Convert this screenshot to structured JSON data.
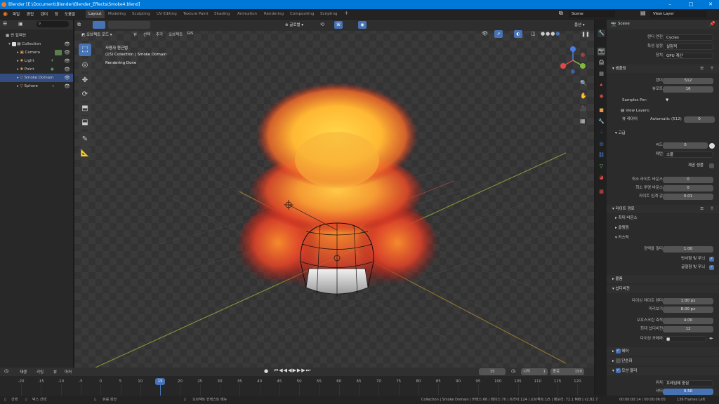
{
  "titlebar": {
    "title": "Blender [E:\\Document\\Blender\\Blender_Effects\\Smoke4.blend]"
  },
  "menu": {
    "items": [
      "파일",
      "편집",
      "렌더",
      "창",
      "도움말"
    ]
  },
  "workspaces": [
    "Layout",
    "Modeling",
    "Sculpting",
    "UV Editing",
    "Texture Paint",
    "Shading",
    "Animation",
    "Rendering",
    "Compositing",
    "Scripting"
  ],
  "scene": {
    "label": "Scene",
    "view_layer": "View Layer"
  },
  "outliner": {
    "root": "씬 컬렉션",
    "collection": "Collection",
    "items": [
      "Camera",
      "Light",
      "Point",
      "Smoke Domain",
      "Sphere"
    ]
  },
  "viewport": {
    "mode": "오브젝트 모드",
    "menus": [
      "뷰",
      "선택",
      "추가",
      "오브젝트",
      "GIS"
    ],
    "orientation": "글로벌",
    "options": "옵션",
    "info_line1": "사용자 원근법",
    "info_line2": "(15) Collection | Smoke Domain",
    "info_line3": "Rendering Done"
  },
  "properties": {
    "header": "Scene",
    "render_engine_label": "렌더 엔진",
    "render_engine": "Cycles",
    "feature_label": "특성 설정",
    "feature": "실험적",
    "device_label": "장치",
    "device": "GPU 계산",
    "sampling": "샘플링",
    "render_label": "렌더",
    "render_val": "512",
    "viewport_label": "뷰포트",
    "viewport_val": "16",
    "samples_per": "Samples Per:",
    "view_layers": "View Layers:",
    "view_layer_label": "뷰 레이어",
    "view_layer_auto": "Automatic (512)",
    "view_layer_val": "0",
    "advanced": "고급",
    "seed_label": "씨드",
    "seed_val": "0",
    "pattern_label": "패턴",
    "pattern": "소볼",
    "square_samples": "제곱 샘플",
    "min_light_bounce_label": "최소 라이트 바운스",
    "min_light_bounce": "0",
    "min_transp_bounce_label": "최소 투명 바운스",
    "min_transp_bounce": "0",
    "light_threshold_label": "라이트 임계 값",
    "light_threshold": "0.01",
    "light_paths": "라이트 경로",
    "max_bounces": "최대 바운스",
    "clamping": "클램핑",
    "caustics": "커스틱",
    "filter_glossy_label": "광택을 필터",
    "filter_glossy": "1.00",
    "reflective_caustics": "반사형 빛 무늬",
    "refractive_caustics": "굴절형 빛 무늬",
    "volumes": "볼륨",
    "subdivision": "섭디비전",
    "dicing_rate_render_label": "다이싱 레이트 렌더",
    "dicing_rate_render": "1.00 px",
    "preview_label": "미리보기",
    "preview": "8.00 px",
    "offscreen_scale_label": "오프스크린 축적",
    "offscreen_scale": "4.00",
    "max_subdiv_label": "최대 섭디비전",
    "max_subdiv": "12",
    "dicing_camera_label": "다이싱 카메라",
    "hair": "헤어",
    "simplify": "단순화",
    "motion_blur": "모션 블러",
    "position_label": "위치",
    "position": "프레임에 중심",
    "shutter_label": "셔터",
    "shutter": "0.50"
  },
  "timeline": {
    "menus": [
      "재생",
      "키잉",
      "뷰",
      "마커"
    ],
    "current_frame": "15",
    "start_label": "시작",
    "start": "1",
    "end_label": "종료",
    "end": "150",
    "ticks": [
      "-20",
      "-15",
      "-10",
      "-5",
      "0",
      "5",
      "10",
      "15",
      "20",
      "25",
      "30",
      "35",
      "40",
      "45",
      "50",
      "55",
      "60",
      "65",
      "70",
      "75",
      "80",
      "85",
      "90",
      "95",
      "100",
      "105",
      "110",
      "115",
      "120"
    ],
    "playhead": "15"
  },
  "statusbar": {
    "select": "선택",
    "box_select": "박스 선택",
    "rotate_view": "뷰를 회전",
    "context_menu": "오브젝트 컨텍스트 메뉴",
    "stats": "Collection | Smoke Domain | 버텍스:66 | 페이스:70 | 트라이:124 | 오브젝트:1/5 | 메모리: 72.1 MiB | v2.82.7",
    "time": "00:00:00:14 / 00:00:06:05",
    "frames_left": "136 Frames Left"
  },
  "colors": {
    "accent": "#4772b3",
    "titlebar": "#0078d7",
    "selected_row": "#334d80"
  }
}
